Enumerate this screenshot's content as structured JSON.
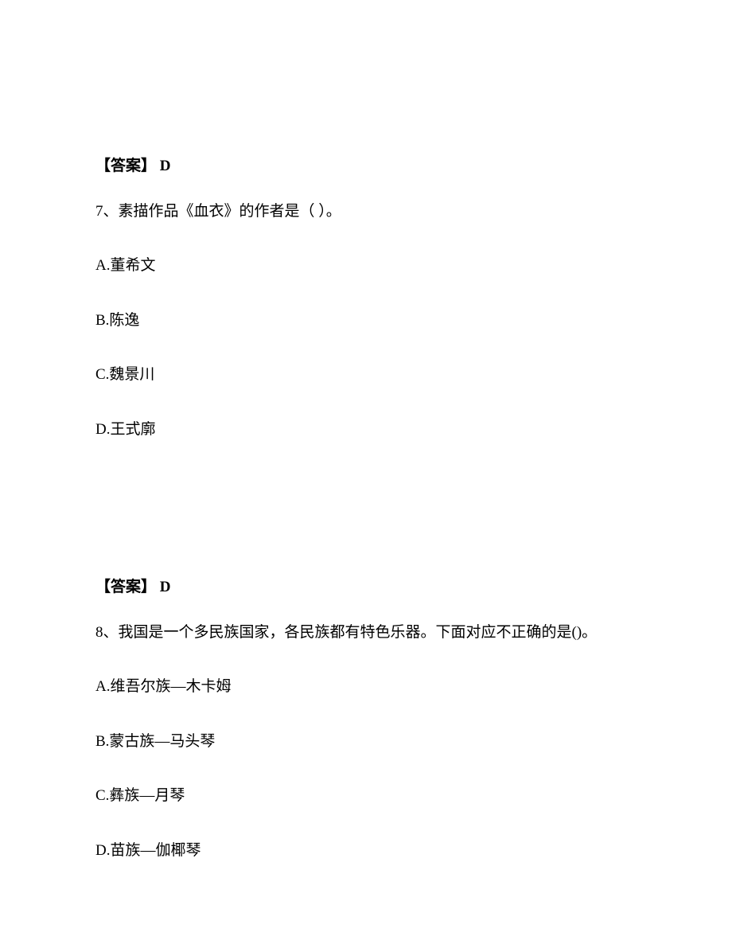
{
  "q7": {
    "prev_answer": "【答案】 D",
    "stem": "7、素描作品《血衣》的作者是（ ）。",
    "options": {
      "A": "A.董希文",
      "B": "B.陈逸",
      "C": "C.魏景川",
      "D": "D.王式廓"
    }
  },
  "q8": {
    "prev_answer": "【答案】 D",
    "stem": "8、我国是一个多民族国家，各民族都有特色乐器。下面对应不正确的是()。",
    "options": {
      "A": "A.维吾尔族—木卡姆",
      "B": "B.蒙古族—马头琴",
      "C": "C.彝族—月琴",
      "D": "D.苗族—伽椰琴"
    }
  }
}
